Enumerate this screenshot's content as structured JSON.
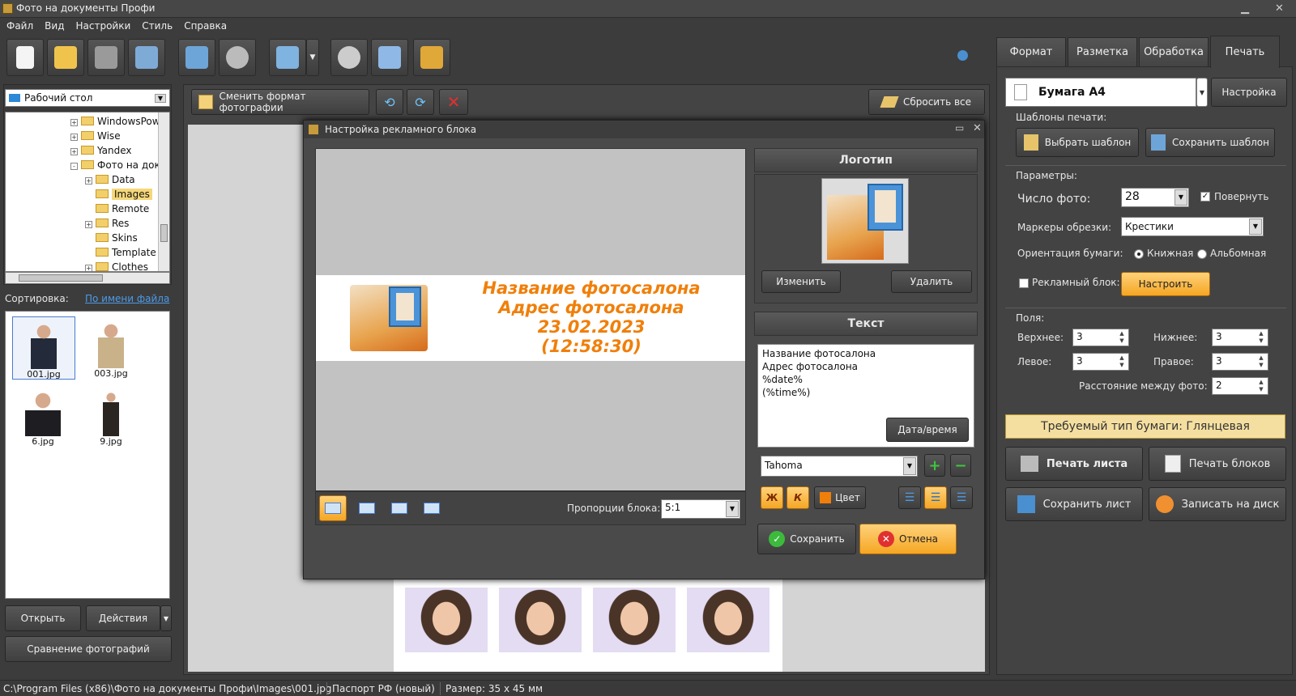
{
  "window": {
    "title": "Фото на документы Профи"
  },
  "menu": [
    "Файл",
    "Вид",
    "Настройки",
    "Стиль",
    "Справка"
  ],
  "toolbar": {
    "icons": [
      "new-page-icon",
      "open-folder-icon",
      "scanner-icon",
      "printer-icon",
      "person-edit-icon",
      "camera-icon",
      "image-editor-icon",
      "film-reel-icon",
      "upload-house-icon",
      "cart-icon"
    ]
  },
  "left": {
    "folder_select": "Рабочий стол",
    "tree": [
      {
        "name": "WindowsPow",
        "level": 1,
        "exp": "+"
      },
      {
        "name": "Wise",
        "level": 1,
        "exp": "+"
      },
      {
        "name": "Yandex",
        "level": 1,
        "exp": "+"
      },
      {
        "name": "Фото на док",
        "level": 1,
        "exp": "-"
      },
      {
        "name": "Data",
        "level": 2,
        "exp": "+"
      },
      {
        "name": "Images",
        "level": 2,
        "exp": "",
        "selected": true
      },
      {
        "name": "Remote",
        "level": 2,
        "exp": ""
      },
      {
        "name": "Res",
        "level": 2,
        "exp": "+"
      },
      {
        "name": "Skins",
        "level": 2,
        "exp": ""
      },
      {
        "name": "Template",
        "level": 2,
        "exp": ""
      },
      {
        "name": "Clothes",
        "level": 2,
        "exp": "+"
      }
    ],
    "sort_label": "Сортировка:",
    "sort_link": "По имени файла",
    "thumbs": [
      "001.jpg",
      "003.jpg",
      "6.jpg",
      "9.jpg"
    ],
    "open_btn": "Открыть",
    "actions_btn": "Действия",
    "compare_btn": "Сравнение фотографий"
  },
  "center": {
    "change_format": "Сменить формат фотографии",
    "reset_all": "Сбросить все"
  },
  "dialog": {
    "title": "Настройка рекламного блока",
    "preview_lines": [
      "Название фотосалона",
      "Адрес фотосалона",
      "23.02.2023",
      "(12:58:30)"
    ],
    "proportion_label": "Пропорции блока:",
    "proportion_value": "5:1",
    "logo_header": "Логотип",
    "logo_change": "Изменить",
    "logo_delete": "Удалить",
    "text_header": "Текст",
    "text_lines": [
      "Название фотосалона",
      "Адрес фотосалона",
      "%date%",
      "(%time%)"
    ],
    "datetime_btn": "Дата/время",
    "font": "Tahoma",
    "bold": "Ж",
    "italic": "К",
    "color_btn": "Цвет",
    "save": "Сохранить",
    "cancel": "Отмена"
  },
  "right": {
    "tabs": [
      "Формат",
      "Разметка",
      "Обработка",
      "Печать"
    ],
    "active_tab": "Печать",
    "paper": "Бумага А4",
    "setup_btn": "Настройка",
    "templates_label": "Шаблоны печати:",
    "choose_template": "Выбрать шаблон",
    "save_template": "Сохранить шаблон",
    "params_label": "Параметры:",
    "count_label": "Число фото:",
    "count_value": "28",
    "rotate_label": "Повернуть",
    "rotate_checked": true,
    "markers_label": "Маркеры обрезки:",
    "markers_value": "Крестики",
    "orient_label": "Ориентация бумаги:",
    "orient_portrait": "Книжная",
    "orient_landscape": "Альбомная",
    "ad_block_label": "Рекламный блок:",
    "ad_block_btn": "Настроить",
    "fields_label": "Поля:",
    "top_label": "Верхнее:",
    "top_value": "3",
    "bottom_label": "Нижнее:",
    "bottom_value": "3",
    "left_label": "Левое:",
    "left_value": "3",
    "right_label": "Правое:",
    "right_value": "3",
    "spacing_label": "Расстояние между фото:",
    "spacing_value": "2",
    "paper_type": "Требуемый тип бумаги: Глянцевая",
    "print_sheet": "Печать листа",
    "print_blocks": "Печать блоков",
    "save_sheet": "Сохранить лист",
    "burn_disc": "Записать на диск"
  },
  "status": {
    "path": "C:\\Program Files (x86)\\Фото на документы Профи\\Images\\001.jpg",
    "doc": "Паспорт РФ (новый)",
    "size": "Размер: 35 x 45 мм"
  },
  "colors": {
    "accent": "#f5a623",
    "preview_text": "#f07f0a",
    "bg": "#3c3c3c"
  }
}
